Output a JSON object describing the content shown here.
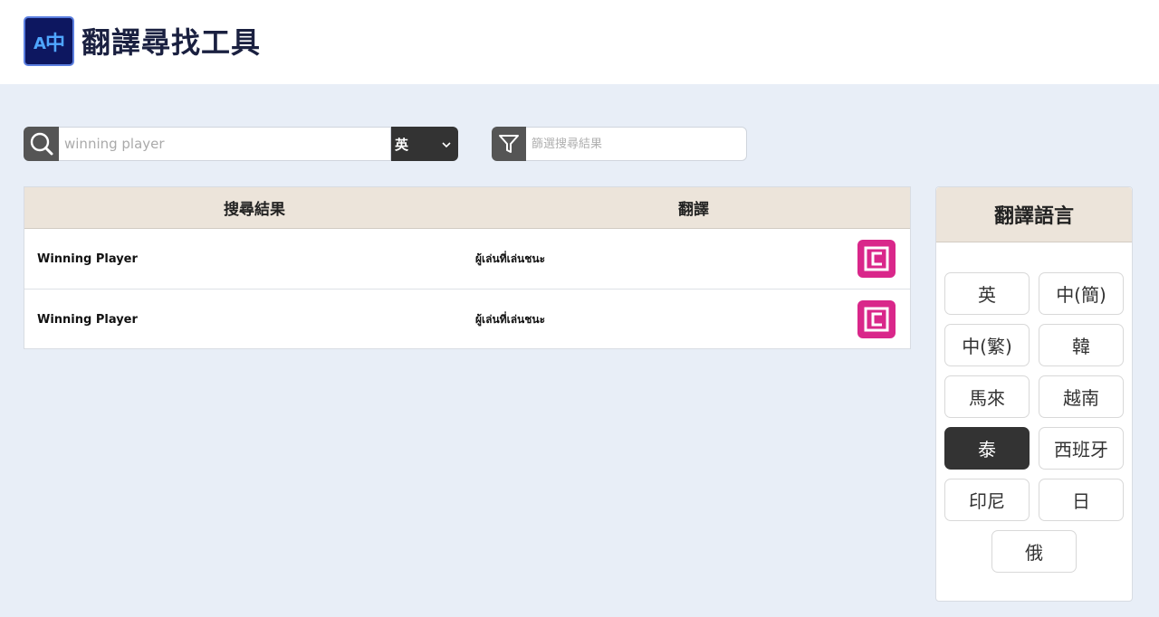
{
  "header": {
    "logo_text_a": "A",
    "logo_text_zh": "中",
    "title": "翻譯尋找工具"
  },
  "search": {
    "value": "",
    "placeholder": "winning player",
    "language": "英"
  },
  "filter": {
    "placeholder": "篩選搜尋結果"
  },
  "results": {
    "col_source": "搜尋結果",
    "col_translation": "翻譯",
    "rows": [
      {
        "source": "Winning Player",
        "translation": "ผู้เล่นที่เล่นชนะ"
      },
      {
        "source": "Winning Player",
        "translation": "ผู้เล่นที่เล่นชนะ"
      }
    ]
  },
  "lang_panel": {
    "title": "翻譯語言",
    "languages": [
      "英",
      "中(簡)",
      "中(繁)",
      "韓",
      "馬來",
      "越南",
      "泰",
      "西班牙",
      "印尼",
      "日",
      "俄"
    ],
    "selected": "泰"
  },
  "colors": {
    "accent_pink": "#d9278a",
    "dark": "#333333",
    "header_bg": "#ece4da",
    "page_bg": "#e8eef7"
  },
  "icons": {
    "search": "search-icon",
    "filter": "filter-icon",
    "dropdown": "chevron-down-icon",
    "copy": "copy-icon"
  }
}
